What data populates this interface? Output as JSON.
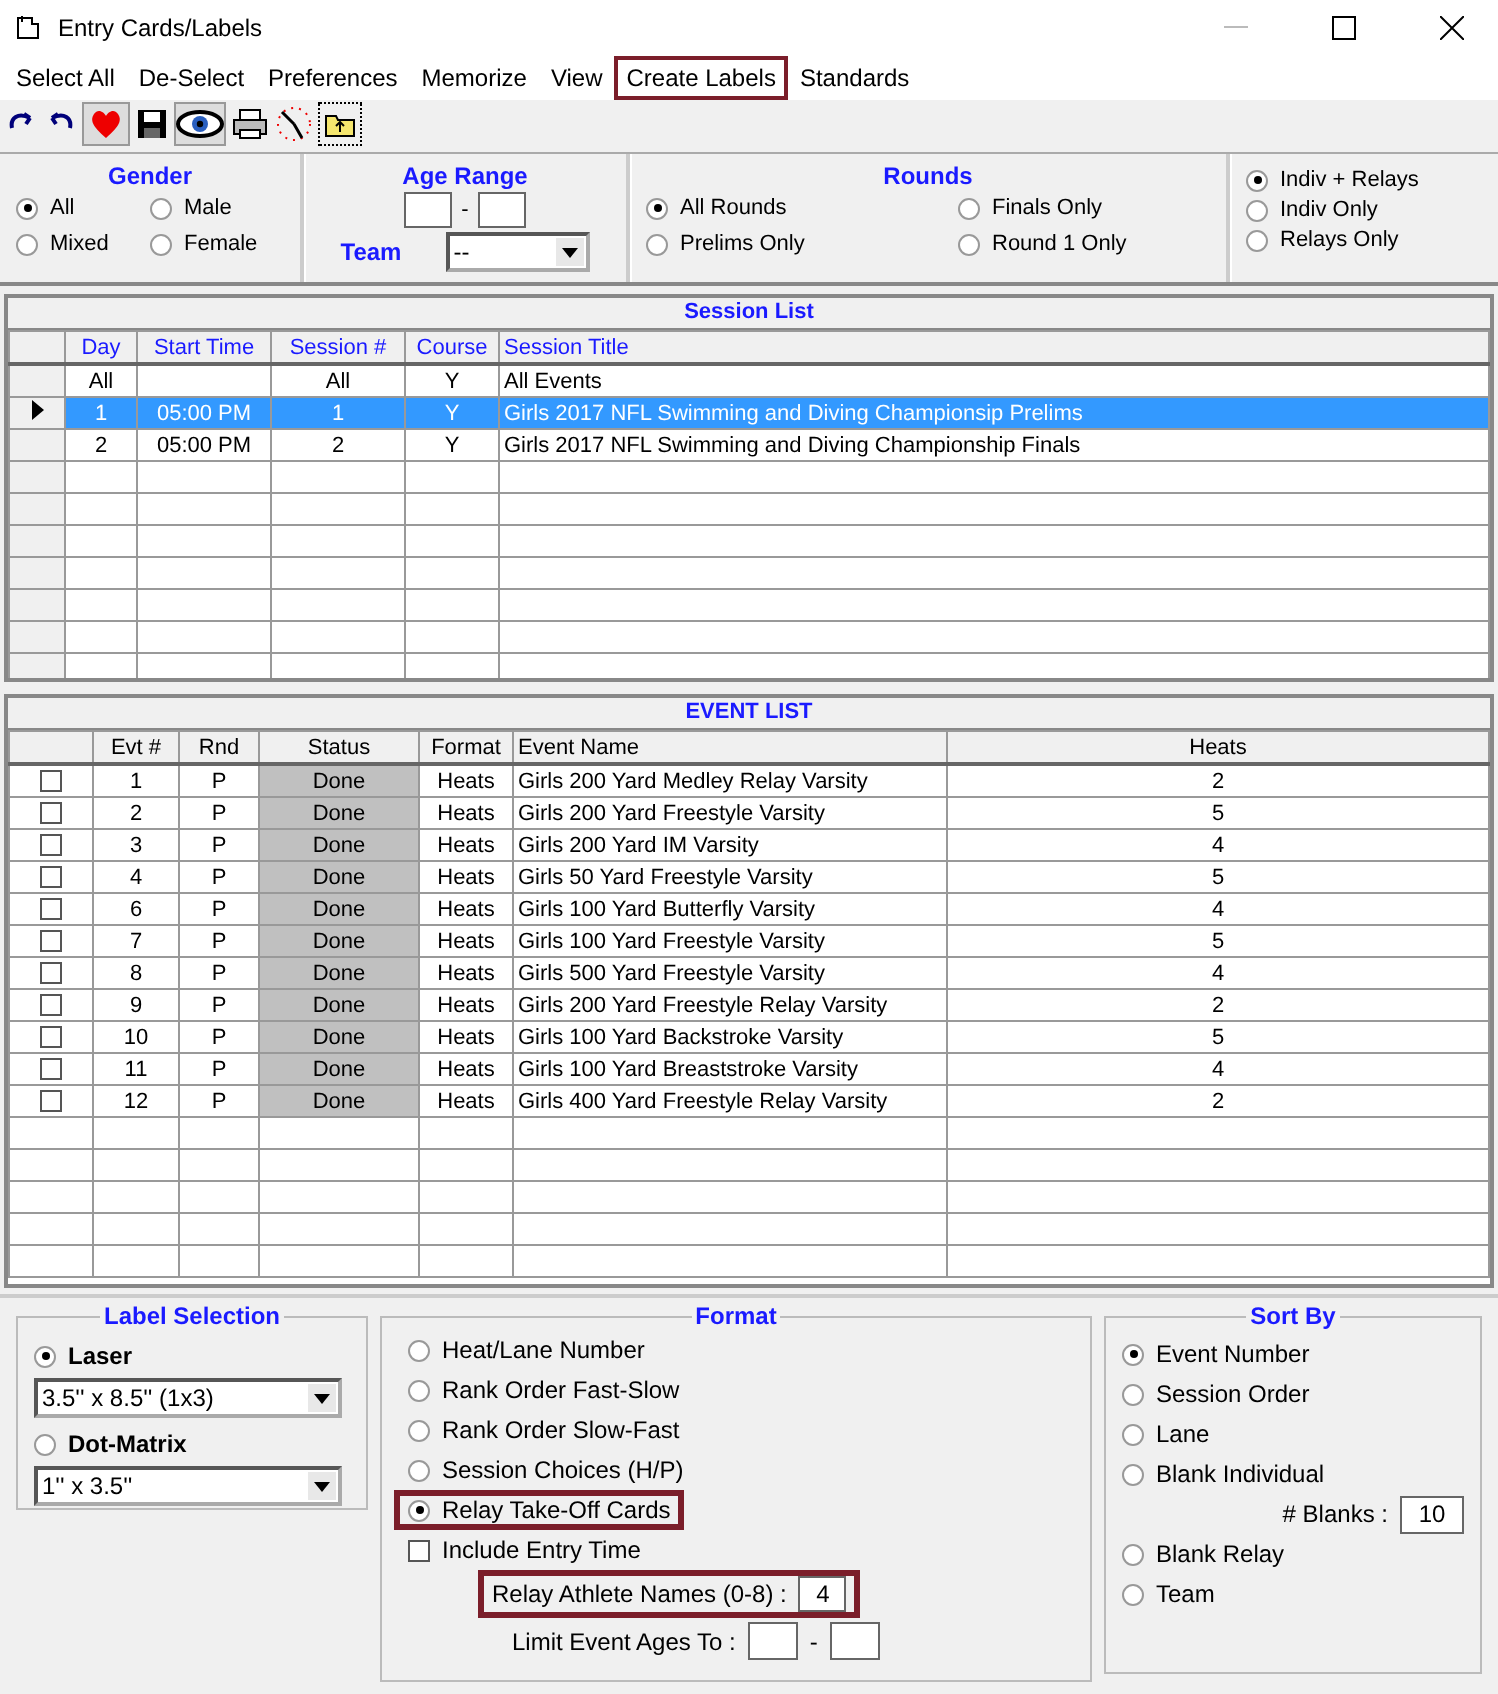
{
  "window": {
    "title": "Entry Cards/Labels"
  },
  "menu": [
    {
      "label": "Select All",
      "highlighted": false
    },
    {
      "label": "De-Select",
      "highlighted": false
    },
    {
      "label": "Preferences",
      "highlighted": false
    },
    {
      "label": "Memorize",
      "highlighted": false
    },
    {
      "label": "View",
      "highlighted": false
    },
    {
      "label": "Create Labels",
      "highlighted": true
    },
    {
      "label": "Standards",
      "highlighted": false
    }
  ],
  "gender": {
    "title": "Gender",
    "options": [
      {
        "label": "All",
        "selected": true
      },
      {
        "label": "Male",
        "selected": false
      },
      {
        "label": "Mixed",
        "selected": false
      },
      {
        "label": "Female",
        "selected": false
      }
    ]
  },
  "age_range": {
    "title": "Age Range",
    "separator": "-",
    "team_label": "Team",
    "team_value": "--"
  },
  "rounds": {
    "title": "Rounds",
    "options": [
      {
        "label": "All Rounds",
        "selected": true
      },
      {
        "label": "Finals Only",
        "selected": false
      },
      {
        "label": "Prelims Only",
        "selected": false
      },
      {
        "label": "Round 1 Only",
        "selected": false
      }
    ]
  },
  "event_types": [
    {
      "label": "Indiv + Relays",
      "selected": true
    },
    {
      "label": "Indiv Only",
      "selected": false
    },
    {
      "label": "Relays Only",
      "selected": false
    }
  ],
  "session_list": {
    "title": "Session List",
    "columns": [
      "Day",
      "Start Time",
      "Session #",
      "Course",
      "Session Title"
    ],
    "rows": [
      {
        "cells": [
          "All",
          "",
          "All",
          "Y",
          "All Events"
        ],
        "selected": false
      },
      {
        "cells": [
          "1",
          "05:00 PM",
          "1",
          "Y",
          "Girls 2017 NFL Swimming and Diving Championsip Prelims"
        ],
        "selected": true
      },
      {
        "cells": [
          "2",
          "05:00 PM",
          "2",
          "Y",
          "Girls 2017 NFL Swimming and Diving Championship Finals"
        ],
        "selected": false
      }
    ]
  },
  "event_list": {
    "title": "EVENT LIST",
    "columns": [
      "Evt #",
      "Rnd",
      "Status",
      "Format",
      "Event Name",
      "Heats"
    ],
    "rows": [
      {
        "checked": false,
        "cells": [
          "1",
          "P",
          "Done",
          "Heats",
          "Girls 200 Yard Medley Relay Varsity",
          "2"
        ]
      },
      {
        "checked": false,
        "cells": [
          "2",
          "P",
          "Done",
          "Heats",
          "Girls 200 Yard Freestyle Varsity",
          "5"
        ]
      },
      {
        "checked": false,
        "cells": [
          "3",
          "P",
          "Done",
          "Heats",
          "Girls 200 Yard IM Varsity",
          "4"
        ]
      },
      {
        "checked": false,
        "cells": [
          "4",
          "P",
          "Done",
          "Heats",
          "Girls 50 Yard Freestyle Varsity",
          "5"
        ]
      },
      {
        "checked": false,
        "cells": [
          "6",
          "P",
          "Done",
          "Heats",
          "Girls 100 Yard Butterfly Varsity",
          "4"
        ]
      },
      {
        "checked": false,
        "cells": [
          "7",
          "P",
          "Done",
          "Heats",
          "Girls 100 Yard Freestyle Varsity",
          "5"
        ]
      },
      {
        "checked": false,
        "cells": [
          "8",
          "P",
          "Done",
          "Heats",
          "Girls 500 Yard Freestyle Varsity",
          "4"
        ]
      },
      {
        "checked": false,
        "cells": [
          "9",
          "P",
          "Done",
          "Heats",
          "Girls 200 Yard Freestyle Relay Varsity",
          "2"
        ]
      },
      {
        "checked": false,
        "cells": [
          "10",
          "P",
          "Done",
          "Heats",
          "Girls 100 Yard Backstroke Varsity",
          "5"
        ]
      },
      {
        "checked": false,
        "cells": [
          "11",
          "P",
          "Done",
          "Heats",
          "Girls 100 Yard Breaststroke Varsity",
          "4"
        ]
      },
      {
        "checked": false,
        "cells": [
          "12",
          "P",
          "Done",
          "Heats",
          "Girls 400 Yard Freestyle Relay Varsity",
          "2"
        ]
      }
    ]
  },
  "label_selection": {
    "title": "Label Selection",
    "options": [
      {
        "label": "Laser",
        "selected": true,
        "dropdown": "3.5'' x 8.5'' (1x3)"
      },
      {
        "label": "Dot-Matrix",
        "selected": false,
        "dropdown": "1'' x 3.5''"
      }
    ]
  },
  "format": {
    "title": "Format",
    "options": [
      {
        "label": "Heat/Lane Number",
        "selected": false,
        "highlighted": false
      },
      {
        "label": "Rank Order Fast-Slow",
        "selected": false,
        "highlighted": false
      },
      {
        "label": "Rank Order Slow-Fast",
        "selected": false,
        "highlighted": false
      },
      {
        "label": "Session Choices (H/P)",
        "selected": false,
        "highlighted": false
      },
      {
        "label": "Relay Take-Off Cards",
        "selected": true,
        "highlighted": true
      }
    ],
    "include_entry_time": {
      "label": "Include Entry Time",
      "checked": false
    },
    "relay_athlete_names": {
      "label": "Relay Athlete Names (0-8) :",
      "value": "4",
      "highlighted": true
    },
    "limit_event_ages": {
      "label": "Limit Event Ages To :",
      "separator": "-"
    }
  },
  "sort_by": {
    "title": "Sort By",
    "options": [
      {
        "kind": "radio",
        "label": "Event Number",
        "selected": true
      },
      {
        "kind": "radio",
        "label": "Session Order",
        "selected": false
      },
      {
        "kind": "radio",
        "label": "Lane",
        "selected": false
      },
      {
        "kind": "radio",
        "label": "Blank Individual",
        "selected": false
      },
      {
        "kind": "field",
        "label": "# Blanks :",
        "value": "10"
      },
      {
        "kind": "radio",
        "label": "Blank Relay",
        "selected": false
      },
      {
        "kind": "radio",
        "label": "Team",
        "selected": false
      }
    ]
  }
}
